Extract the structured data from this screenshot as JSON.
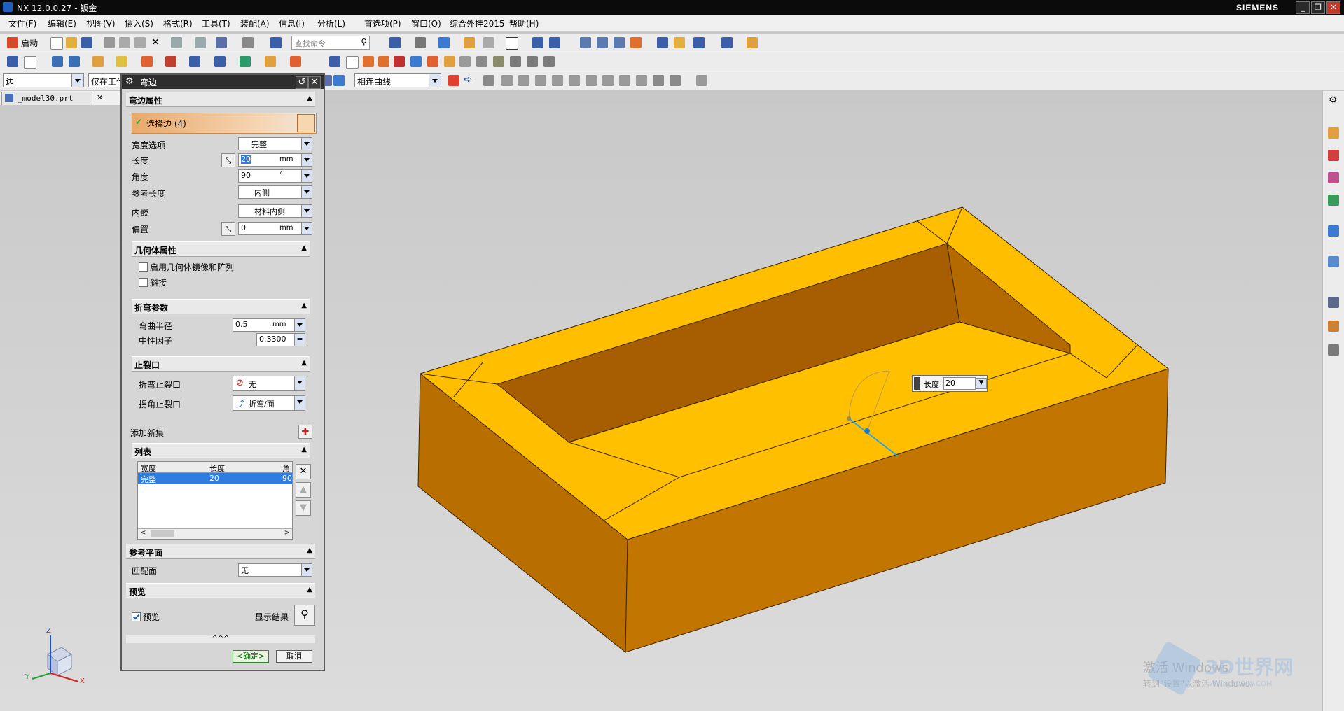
{
  "titlebar": {
    "title": "NX 12.0.0.27 - 钣金",
    "brand": "SIEMENS"
  },
  "menu": [
    "文件(F)",
    "编辑(E)",
    "视图(V)",
    "插入(S)",
    "格式(R)",
    "工具(T)",
    "装配(A)",
    "信息(I)",
    "分析(L)",
    "首选项(P)",
    "窗口(O)",
    "综合外挂2015",
    "帮助(H)"
  ],
  "toolbar": {
    "start_label": "启动",
    "search_placeholder": "查找命令"
  },
  "selbar": {
    "filter_value": "边",
    "scope_value": "仅在工作",
    "curve_rule": "相连曲线"
  },
  "tab": {
    "file_name": "_model30.prt"
  },
  "dialog": {
    "title": "弯边",
    "s1": {
      "header": "弯边属性",
      "select_edge": "选择边 (4)",
      "width_option_label": "宽度选项",
      "width_option_value": "完整",
      "length_label": "长度",
      "length_value": "20",
      "length_unit": "mm",
      "angle_label": "角度",
      "angle_value": "90",
      "angle_unit": "°",
      "ref_length_label": "参考长度",
      "ref_length_value": "内侧",
      "inset_label": "内嵌",
      "inset_value": "材料内侧",
      "offset_label": "偏置",
      "offset_value": "0",
      "offset_unit": "mm"
    },
    "s2": {
      "header": "几何体属性",
      "mirror_label": "启用几何体镜像和阵列",
      "miter_label": "斜接"
    },
    "s3": {
      "header": "折弯参数",
      "radius_label": "弯曲半径",
      "radius_value": "0.5",
      "radius_unit": "mm",
      "kfactor_label": "中性因子",
      "kfactor_value": "0.3300"
    },
    "s4": {
      "header": "止裂口",
      "bend_relief_label": "折弯止裂口",
      "bend_relief_value": "无",
      "corner_relief_label": "拐角止裂口",
      "corner_relief_value": "折弯/面"
    },
    "add_set_label": "添加新集",
    "s5": {
      "header": "列表",
      "col_width": "宽度",
      "col_length": "长度",
      "col_angle": "角",
      "row_width": "完整",
      "row_length": "20",
      "row_angle": "90"
    },
    "s6": {
      "header": "参考平面",
      "match_face_label": "匹配面",
      "match_face_value": "无"
    },
    "s7": {
      "header": "预览",
      "preview_label": "预览",
      "show_result_label": "显示结果"
    },
    "expand": "^^^",
    "ok_label": "<确定>",
    "cancel_label": "取消"
  },
  "tooltip": {
    "label": "长度",
    "value": "20"
  },
  "triad": {
    "x": "X",
    "y": "Y",
    "z": "Z"
  },
  "watermark": {
    "activate": "激活 Windows",
    "activate_sub": "转到\"设置\"以激活 Windows。",
    "site": "3D世界网",
    "site_url": "WWW.3DSJW.COM"
  },
  "colors": {
    "model_top": "#ffbf00",
    "model_side": "#c37300",
    "model_dark": "#a85f00",
    "accent": "#2f7de1"
  }
}
